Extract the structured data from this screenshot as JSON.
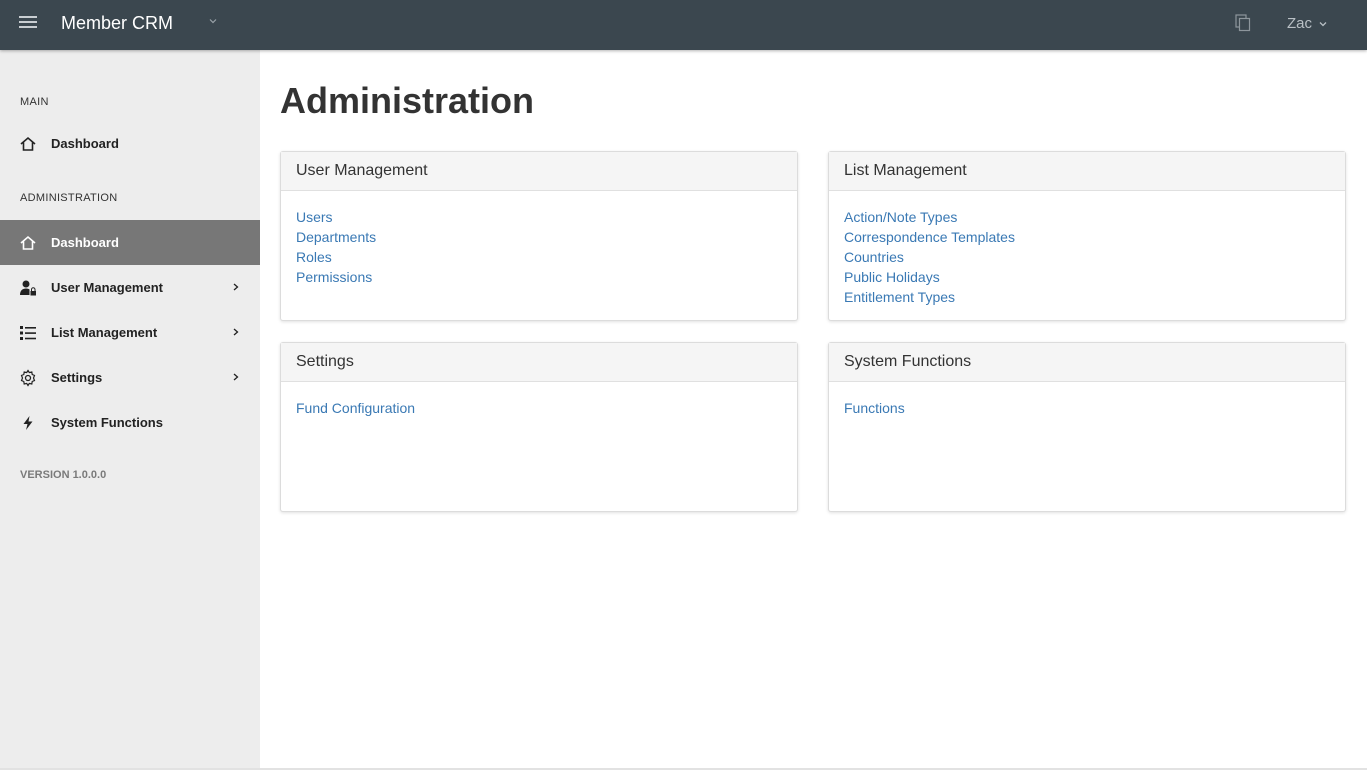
{
  "header": {
    "app_title": "Member CRM",
    "user_name": "Zac",
    "background_color": "#3b474f"
  },
  "sidebar": {
    "main_label": "MAIN",
    "main_items": [
      {
        "label": "Dashboard",
        "icon": "home-icon"
      }
    ],
    "admin_label": "ADMINISTRATION",
    "admin_items": [
      {
        "label": "Dashboard",
        "icon": "home-icon",
        "active": true
      },
      {
        "label": "User Management",
        "icon": "user-lock-icon",
        "has_submenu": true
      },
      {
        "label": "List Management",
        "icon": "list-icon",
        "has_submenu": true
      },
      {
        "label": "Settings",
        "icon": "gear-icon",
        "has_submenu": true
      },
      {
        "label": "System Functions",
        "icon": "bolt-icon"
      }
    ],
    "version": "VERSION 1.0.0.0"
  },
  "main": {
    "title": "Administration",
    "panels": [
      {
        "title": "User Management",
        "links": [
          "Users",
          "Departments",
          "Roles",
          "Permissions"
        ]
      },
      {
        "title": "List Management",
        "links": [
          "Action/Note Types",
          "Correspondence Templates",
          "Countries",
          "Public Holidays",
          "Entitlement Types"
        ]
      },
      {
        "title": "Settings",
        "links": [
          "Fund Configuration"
        ]
      },
      {
        "title": "System Functions",
        "links": [
          "Functions"
        ]
      }
    ]
  },
  "colors": {
    "link": "#3a79b4",
    "active_nav": "#777777",
    "sidebar_bg": "#ededed"
  }
}
